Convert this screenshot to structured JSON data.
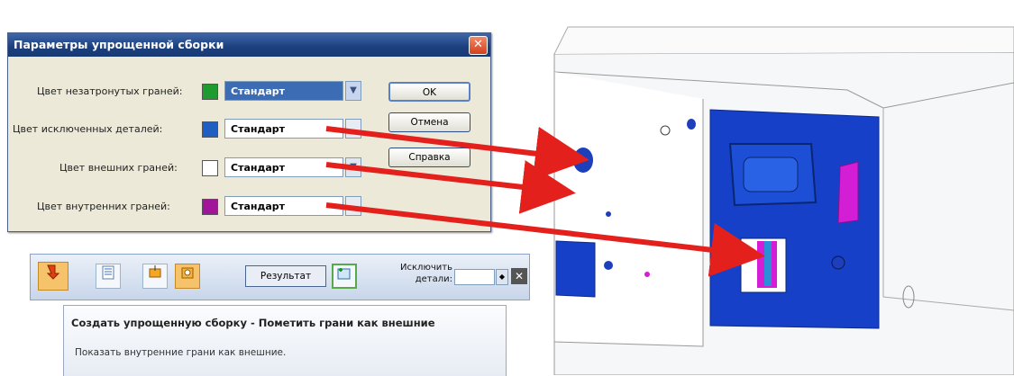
{
  "dialog": {
    "title": "Параметры упрощенной сборки",
    "close_glyph": "✕",
    "rows": [
      {
        "label": "Цвет незатронутых граней:",
        "swatch_color": "#1f9a2e",
        "value": "Стандарт"
      },
      {
        "label": "Цвет исключенных деталей:",
        "swatch_color": "#1f5fc2",
        "value": "Стандарт"
      },
      {
        "label": "Цвет внешних граней:",
        "swatch_color": "#ffffff",
        "value": "Стандарт"
      },
      {
        "label": "Цвет внутренних граней:",
        "swatch_color": "#a0159a",
        "value": "Стандарт"
      }
    ],
    "buttons": {
      "ok": "OK",
      "cancel": "Отмена",
      "help": "Справка"
    }
  },
  "toolbar": {
    "result_label": "Результат",
    "exclude_label_line1": "Исключить",
    "exclude_label_line2": "детали:",
    "exclude_value": "",
    "icons": [
      "finish-icon",
      "list-icon",
      "select-parts-icon",
      "outer-faces-icon",
      "add-view-icon",
      "close-icon"
    ]
  },
  "tooltip": {
    "title": "Создать упрощенную сборку - Пометить грани как внешние",
    "description": "Показать внутренние грани как внешние."
  },
  "colors": {
    "arrow": "#e3201b",
    "model_blue": "#1740c8",
    "magenta": "#d41ed6",
    "accent": "#f6c36a"
  }
}
